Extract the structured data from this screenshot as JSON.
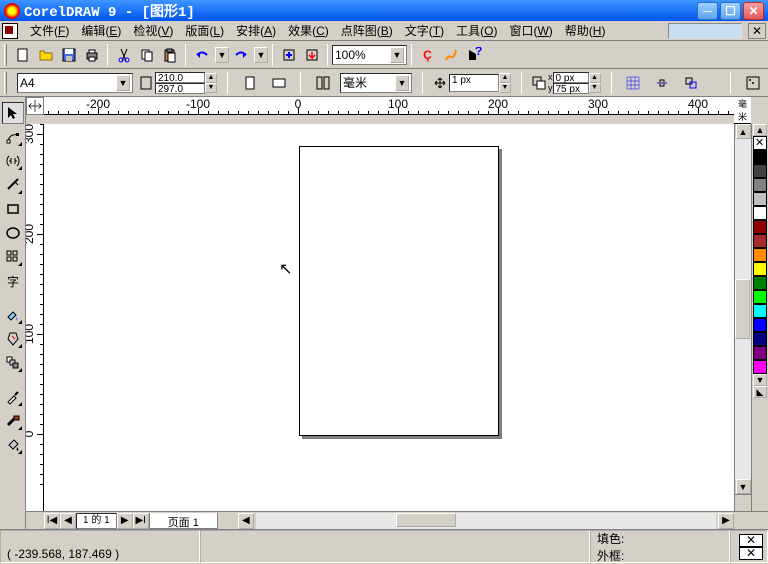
{
  "titlebar": {
    "text": "CorelDRAW 9 - [图形1]"
  },
  "menu": {
    "items": [
      {
        "label": "文件",
        "key": "F"
      },
      {
        "label": "编辑",
        "key": "E"
      },
      {
        "label": "检视",
        "key": "V"
      },
      {
        "label": "版面",
        "key": "L"
      },
      {
        "label": "安排",
        "key": "A"
      },
      {
        "label": "效果",
        "key": "C"
      },
      {
        "label": "点阵图",
        "key": "B"
      },
      {
        "label": "文字",
        "key": "T"
      },
      {
        "label": "工具",
        "key": "O"
      },
      {
        "label": "窗口",
        "key": "W"
      },
      {
        "label": "帮助",
        "key": "H"
      }
    ]
  },
  "toolbar1": {
    "zoom": "100%"
  },
  "props": {
    "paper": "A4",
    "width": "210.0 mm",
    "height": "297.0 mm",
    "units": "毫米",
    "nudge": "1 px",
    "dup_x": "0 px",
    "dup_y": "75 px",
    "units_label": "毫米"
  },
  "ruler": {
    "h_ticks": [
      -200,
      -100,
      0,
      100,
      200,
      300,
      400
    ],
    "v_ticks": [
      300,
      200,
      100,
      0
    ],
    "units_label": "毫米"
  },
  "page_nav": {
    "count_text": "1 的 1",
    "tab_label": "页面   1"
  },
  "status": {
    "coords": "( -239.568, 187.469 )",
    "fill_label": "填色:",
    "outline_label": "外框:"
  },
  "palette": {
    "colors": [
      "#000000",
      "#404040",
      "#808080",
      "#c0c0c0",
      "#ffffff",
      "#8b0000",
      "#a52a2a",
      "#ff8c00",
      "#ffff00",
      "#008000",
      "#00ff00",
      "#00ffff",
      "#0000ff",
      "#000080",
      "#800080",
      "#ff00ff"
    ]
  },
  "chart_data": {
    "type": "table",
    "note": "Blank A4 canvas (210×297mm), no chart data present"
  }
}
